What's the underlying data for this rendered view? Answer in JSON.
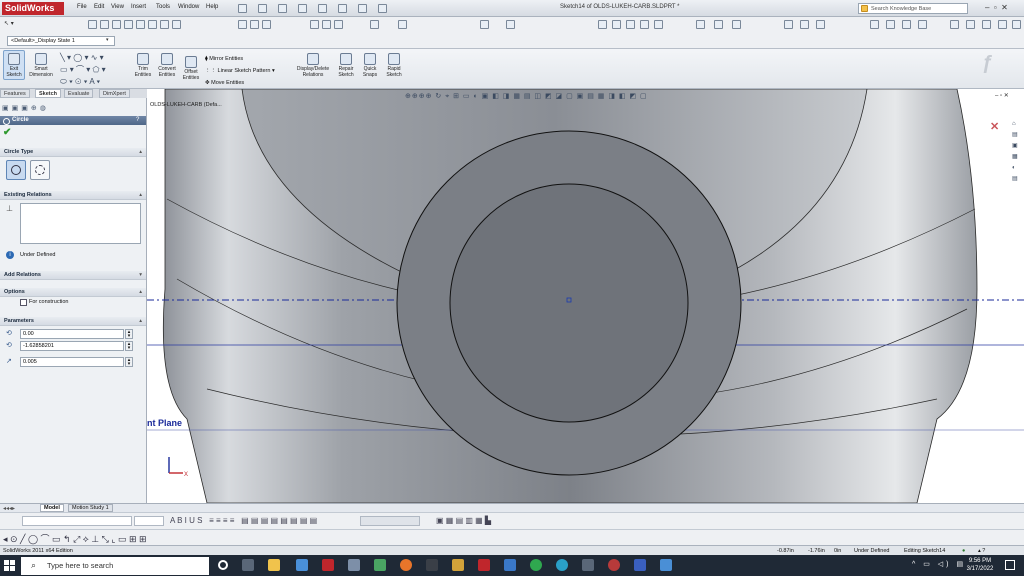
{
  "app": {
    "logo": "SolidWorks",
    "doc_title": "Sketch14 of OLDS-LUKEH-CARB.SLDPRT *"
  },
  "menu": [
    "File",
    "Edit",
    "View",
    "Insert",
    "Tools",
    "Window",
    "Help"
  ],
  "search": {
    "placeholder": "Search Knowledge Base"
  },
  "config": {
    "value": "<Default>_Display State 1"
  },
  "ribbon": {
    "exit_sketch": "Exit Sketch",
    "smart_dimension": "Smart Dimension",
    "trim_entities": "Trim Entities",
    "convert_entities": "Convert Entities",
    "offset_entities": "Offset Entities",
    "mirror_entities": "Mirror Entities",
    "linear_pattern": "Linear Sketch Pattern",
    "move_entities": "Move Entities",
    "display_delete_relations": "Display/Delete Relations",
    "repair_sketch": "Repair Sketch",
    "quick_snaps": "Quick Snaps",
    "rapid_sketch": "Rapid Sketch"
  },
  "tabs": [
    "Features",
    "Sketch",
    "Evaluate",
    "DimXpert"
  ],
  "tree_item": "OLDS-LUKEH-CARB (Defa...",
  "panel": {
    "title": "Circle",
    "circle_type": "Circle Type",
    "existing_relations": "Existing Relations",
    "under_defined": "Under Defined",
    "add_relations": "Add Relations",
    "options": "Options",
    "for_construction": "For construction",
    "parameters": "Parameters",
    "param_x": "0.00",
    "param_y": "-1.62858201",
    "param_r": "0.005"
  },
  "viewport": {
    "plane_label": "nt Plane"
  },
  "bottom_tabs": [
    "Model",
    "Motion Study 1"
  ],
  "status": {
    "edition": "SolidWorks 2011 x64 Edition",
    "x": "-0.87in",
    "y": "-1.76in",
    "z": "0in",
    "state": "Under Defined",
    "editing": "Editing Sketch14"
  },
  "taskbar": {
    "search_placeholder": "Type here to search",
    "time": "9:56 PM",
    "date": "3/17/2022"
  },
  "colors": {
    "accent": "#4f6788",
    "part_gray": "#8c9097",
    "sketch_line": "#1a1a2e",
    "axis_blue": "#2a3aa0"
  }
}
